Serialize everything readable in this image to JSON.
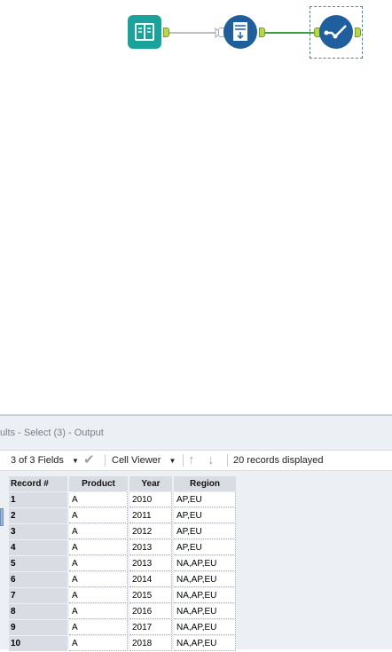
{
  "canvas": {
    "tools": [
      {
        "name": "input-tool",
        "icon": "book-icon",
        "color": "#1aa39a"
      },
      {
        "name": "text-to-columns-tool",
        "icon": "form-download-icon",
        "color": "#1f5f9e"
      },
      {
        "name": "select-tool",
        "icon": "check-path-icon",
        "color": "#1f5f9e",
        "selected": true
      }
    ],
    "connection_colors": {
      "inactive": "#a5a9ae",
      "active": "#3aa04a"
    }
  },
  "results": {
    "title": "ults - Select (3) - Output",
    "toolbar": {
      "fields_label": "3 of 3 Fields",
      "viewer_label": "Cell Viewer",
      "records_label": "20 records displayed"
    },
    "table": {
      "columns": [
        "Record #",
        "Product",
        "Year",
        "Region"
      ],
      "rows": [
        [
          "1",
          "A",
          "2010",
          "AP,EU"
        ],
        [
          "2",
          "A",
          "2011",
          "AP,EU"
        ],
        [
          "3",
          "A",
          "2012",
          "AP,EU"
        ],
        [
          "4",
          "A",
          "2013",
          "AP,EU"
        ],
        [
          "5",
          "A",
          "2013",
          "NA,AP,EU"
        ],
        [
          "6",
          "A",
          "2014",
          "NA,AP,EU"
        ],
        [
          "7",
          "A",
          "2015",
          "NA,AP,EU"
        ],
        [
          "8",
          "A",
          "2016",
          "NA,AP,EU"
        ],
        [
          "9",
          "A",
          "2017",
          "NA,AP,EU"
        ],
        [
          "10",
          "A",
          "2018",
          "NA,AP,EU"
        ]
      ]
    }
  }
}
